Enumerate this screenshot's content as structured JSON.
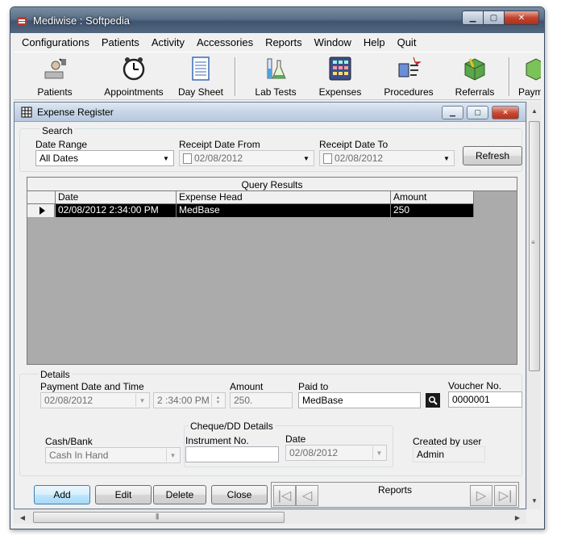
{
  "app": {
    "title": "Mediwise : Softpedia",
    "colors": {
      "titlebar": "#53677f",
      "selection": "#000000",
      "workspace": "#ababab"
    }
  },
  "menu": [
    "Configurations",
    "Patients",
    "Activity",
    "Accessories",
    "Reports",
    "Window",
    "Help",
    "Quit"
  ],
  "toolbar": {
    "patients": "Patients",
    "appointments": "Appointments",
    "day_sheet": "Day Sheet",
    "lab_tests": "Lab Tests",
    "expenses": "Expenses",
    "procedures": "Procedures",
    "referrals": "Referrals",
    "payments": "Paym"
  },
  "child": {
    "title": "Expense Register",
    "search": {
      "group_label": "Search",
      "date_range_label": "Date Range",
      "date_range_value": "All Dates",
      "receipt_from_label": "Receipt Date From",
      "receipt_from_value": "02/08/2012",
      "receipt_to_label": "Receipt Date To",
      "receipt_to_value": "02/08/2012",
      "refresh_label": "Refresh"
    },
    "results": {
      "caption": "Query Results",
      "columns": [
        "Date",
        "Expense Head",
        "Amount"
      ],
      "rows": [
        {
          "date": "02/08/2012 2:34:00 PM",
          "expense_head": "MedBase",
          "amount": "250"
        }
      ]
    },
    "details": {
      "group_label": "Details",
      "payment_dt_label": "Payment Date and Time",
      "payment_date": "02/08/2012",
      "payment_time": "2 :34:00 PM",
      "amount_label": "Amount",
      "amount_value": "250.",
      "paid_to_label": "Paid to",
      "paid_to_value": "MedBase",
      "voucher_label": "Voucher  No.",
      "voucher_value": "0000001",
      "cash_bank_label": "Cash/Bank",
      "cash_bank_value": "Cash In Hand",
      "cheque_group_label": "Cheque/DD Details",
      "instrument_label": "Instrument  No.",
      "instrument_value": "",
      "cheque_date_label": "Date",
      "cheque_date_value": "02/08/2012",
      "created_by_label": "Created by user",
      "created_by_value": "Admin"
    },
    "actions": {
      "add": "Add",
      "edit": "Edit",
      "delete": "Delete",
      "close": "Close"
    },
    "reports_nav": {
      "title": "Reports"
    }
  }
}
